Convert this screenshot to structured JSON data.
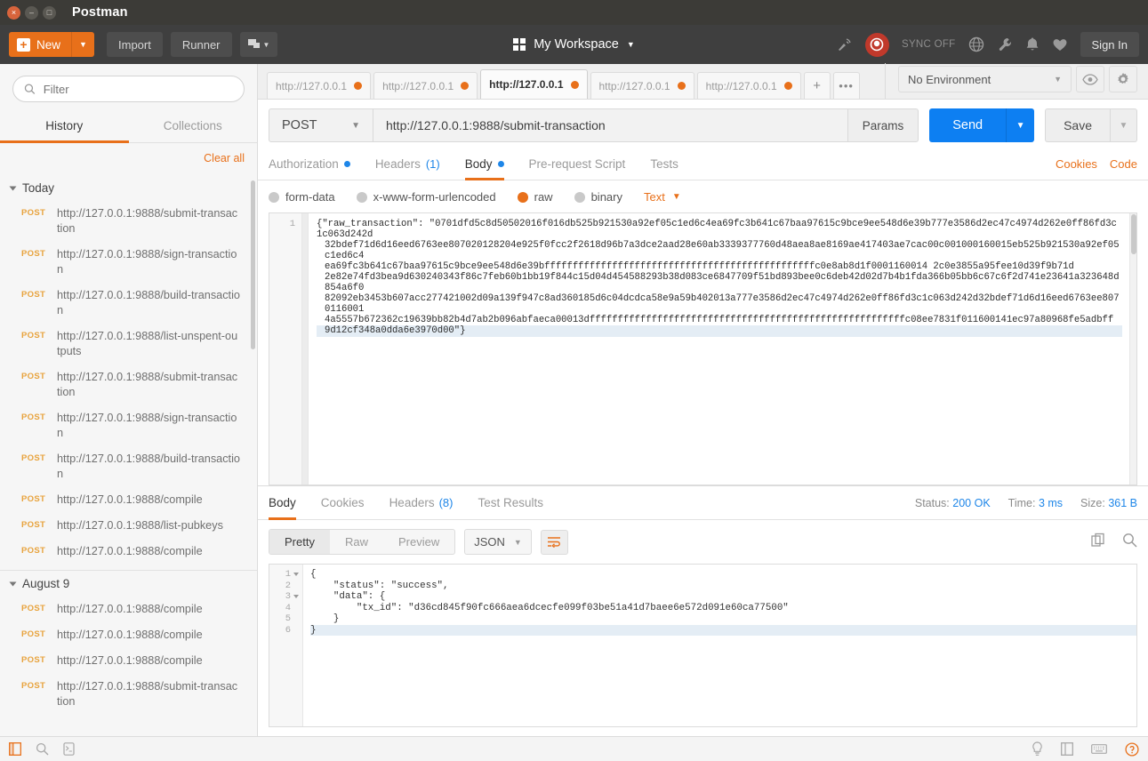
{
  "window": {
    "title": "Postman",
    "controls": {
      "close": "×",
      "minimize": "–",
      "maximize": "□"
    }
  },
  "toolbar": {
    "new_label": "New",
    "import_label": "Import",
    "runner_label": "Runner",
    "workspace_label": "My Workspace",
    "sync_status": "SYNC OFF",
    "signin_label": "Sign In",
    "icons": [
      "new-icon",
      "import-icon",
      "runner-icon",
      "new-window-icon",
      "grid-icon",
      "antenna-icon",
      "postman-orb-icon",
      "globe-icon",
      "wrench-icon",
      "bell-icon",
      "heart-icon"
    ]
  },
  "sidebar": {
    "filter_placeholder": "Filter",
    "tabs": [
      {
        "label": "History",
        "active": true
      },
      {
        "label": "Collections",
        "active": false
      }
    ],
    "clear_all": "Clear all",
    "groups": [
      {
        "name": "Today",
        "items": [
          {
            "method": "POST",
            "url": "http://127.0.0.1:9888/submit-transaction"
          },
          {
            "method": "POST",
            "url": "http://127.0.0.1:9888/sign-transaction"
          },
          {
            "method": "POST",
            "url": "http://127.0.0.1:9888/build-transaction"
          },
          {
            "method": "POST",
            "url": "http://127.0.0.1:9888/list-unspent-outputs"
          },
          {
            "method": "POST",
            "url": "http://127.0.0.1:9888/submit-transaction"
          },
          {
            "method": "POST",
            "url": "http://127.0.0.1:9888/sign-transaction"
          },
          {
            "method": "POST",
            "url": "http://127.0.0.1:9888/build-transaction"
          },
          {
            "method": "POST",
            "url": "http://127.0.0.1:9888/compile"
          },
          {
            "method": "POST",
            "url": "http://127.0.0.1:9888/list-pubkeys"
          },
          {
            "method": "POST",
            "url": "http://127.0.0.1:9888/compile"
          }
        ]
      },
      {
        "name": "August 9",
        "items": [
          {
            "method": "POST",
            "url": "http://127.0.0.1:9888/compile"
          },
          {
            "method": "POST",
            "url": "http://127.0.0.1:9888/compile"
          },
          {
            "method": "POST",
            "url": "http://127.0.0.1:9888/compile"
          },
          {
            "method": "POST",
            "url": "http://127.0.0.1:9888/submit-transaction"
          }
        ]
      }
    ]
  },
  "request_tabs": {
    "tabs": [
      {
        "label": "http://127.0.0.1",
        "active": false
      },
      {
        "label": "http://127.0.0.1",
        "active": false
      },
      {
        "label": "http://127.0.0.1",
        "active": true
      },
      {
        "label": "http://127.0.0.1",
        "active": false
      },
      {
        "label": "http://127.0.0.1",
        "active": false
      }
    ],
    "add_label": "+",
    "more_label": "•••",
    "environment": "No Environment"
  },
  "request": {
    "method": "POST",
    "url": "http://127.0.0.1:9888/submit-transaction",
    "params_label": "Params",
    "send_label": "Send",
    "save_label": "Save",
    "tabs": [
      {
        "label": "Authorization",
        "dot": true,
        "active": false
      },
      {
        "label": "Headers",
        "count": "(1)",
        "active": false
      },
      {
        "label": "Body",
        "dot": true,
        "active": true
      },
      {
        "label": "Pre-request Script",
        "active": false
      },
      {
        "label": "Tests",
        "active": false
      }
    ],
    "links": [
      "Cookies",
      "Code"
    ],
    "body_modes": [
      {
        "label": "form-data",
        "selected": false
      },
      {
        "label": "x-www-form-urlencoded",
        "selected": false
      },
      {
        "label": "raw",
        "selected": true
      },
      {
        "label": "binary",
        "selected": false
      }
    ],
    "raw_type": "Text",
    "line_number": "1",
    "body_lines": [
      "{\"raw_transaction\": \"0701dfd5c8d50502016f016db525b921530a92ef05c1ed6c4ea69fc3b641c67baa97615c9bce9ee548d6e39b777e3586d2ec47c4974d262e0ff86fd3c1c063d242d",
      "32bdef71d6d16eed6763ee807020128204e925f0fcc2f2618d96b7a3dce2aad28e60ab3339377760d48aea8ae8169ae417403ae7cac00c001000160015eb525b921530a92ef05c1ed6c4",
      "ea69fc3b641c67baa97615c9bce9ee548d6e39bffffffffffffffffffffffffffffffffffffffffffffffffc0e8ab8d1f0001160014 2c0e3855a95fee10d39f9b71d",
      "2e82e74fd3bea9d630240343f86c7feb60b1bb19f844c15d04d454588293b38d083ce6847709f51bd893bee0c6deb42d02d7b4b1fda366b05bb6c67c6f2d741e23641a323648d854a6f0",
      "82092eb3453b607acc277421002d09a139f947c8ad360185d6c04dcdca58e9a59b402013a777e3586d2ec47c4974d262e0ff86fd3c1c063d242d32bdef71d6d16eed6763ee8070116001",
      "4a5557b672362c19639bb82b4d7ab2b096abfaeca00013dffffffffffffffffffffffffffffffffffffffffffffffffffffffffc08ee7831f011600141ec97a80968fe5adbff",
      "9d12cf348a0dda6e3970d00\"}"
    ]
  },
  "response": {
    "tabs": [
      {
        "label": "Body",
        "active": true
      },
      {
        "label": "Cookies",
        "active": false
      },
      {
        "label": "Headers",
        "count": "(8)",
        "active": false
      },
      {
        "label": "Test Results",
        "active": false
      }
    ],
    "status_label": "Status:",
    "status_value": "200 OK",
    "time_label": "Time:",
    "time_value": "3 ms",
    "size_label": "Size:",
    "size_value": "361 B",
    "view_modes": [
      {
        "label": "Pretty",
        "active": true
      },
      {
        "label": "Raw",
        "active": false
      },
      {
        "label": "Preview",
        "active": false
      }
    ],
    "format": "JSON",
    "icons": [
      "wrap-lines-icon",
      "copy-icon",
      "search-icon"
    ],
    "code_lines": [
      {
        "num": "1",
        "fold": true,
        "text": "{"
      },
      {
        "num": "2",
        "fold": false,
        "text": "    \"status\": \"success\","
      },
      {
        "num": "3",
        "fold": true,
        "text": "    \"data\": {"
      },
      {
        "num": "4",
        "fold": false,
        "text": "        \"tx_id\": \"d36cd845f90fc666aea6dcecfe099f03be51a41d7baee6e572d091e60ca77500\""
      },
      {
        "num": "5",
        "fold": false,
        "text": "    }"
      },
      {
        "num": "6",
        "fold": false,
        "text": "}"
      }
    ]
  },
  "statusbar": {
    "left_icons": [
      "sidebar-toggle-icon",
      "find-icon",
      "console-icon"
    ],
    "right_icons": [
      "bulb-icon",
      "layout-icon",
      "keyboard-icon",
      "help-icon"
    ]
  },
  "colors": {
    "accent": "#e8701a",
    "send": "#0d7ff2",
    "link": "#1e86e8",
    "titlebar": "#3c3b37"
  }
}
